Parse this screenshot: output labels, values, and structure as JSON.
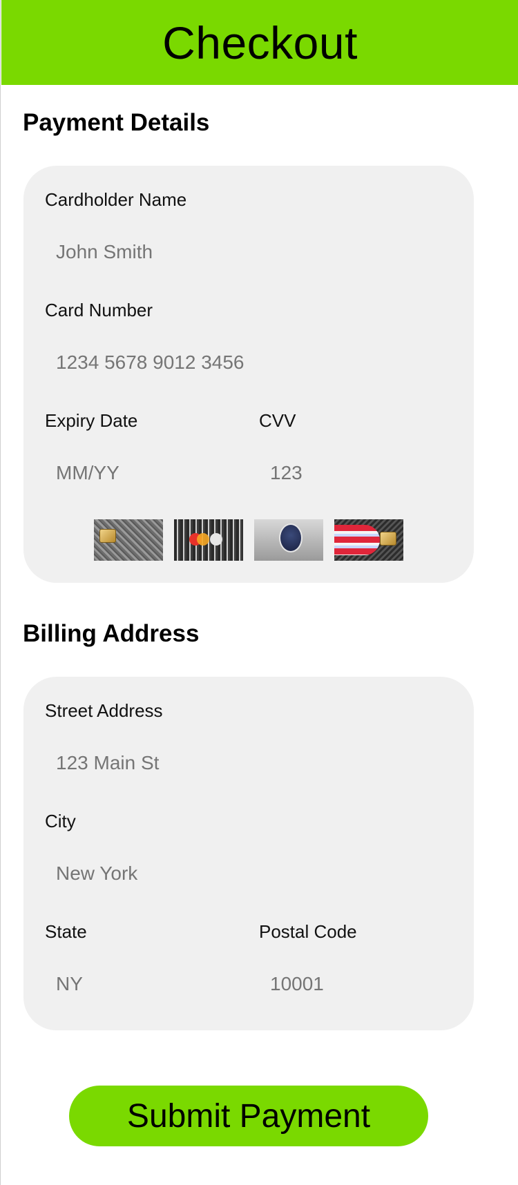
{
  "header": {
    "title": "Checkout"
  },
  "payment": {
    "section_title": "Payment Details",
    "cardholder_label": "Cardholder Name",
    "cardholder_placeholder": "John Smith",
    "card_number_label": "Card Number",
    "card_number_placeholder": "1234 5678 9012 3456",
    "expiry_label": "Expiry Date",
    "expiry_placeholder": "MM/YY",
    "cvv_label": "CVV",
    "cvv_placeholder": "123",
    "card_logos": [
      "visa-card-icon",
      "mastercard-card-icon",
      "amex-card-icon",
      "discover-card-icon"
    ]
  },
  "billing": {
    "section_title": "Billing Address",
    "street_label": "Street Address",
    "street_placeholder": "123 Main St",
    "city_label": "City",
    "city_placeholder": "New York",
    "state_label": "State",
    "state_placeholder": "NY",
    "postal_label": "Postal Code",
    "postal_placeholder": "10001"
  },
  "actions": {
    "submit_label": "Submit Payment"
  },
  "colors": {
    "accent": "#7ad900",
    "panel": "#f0f0f0",
    "placeholder": "#8d9bb3"
  }
}
